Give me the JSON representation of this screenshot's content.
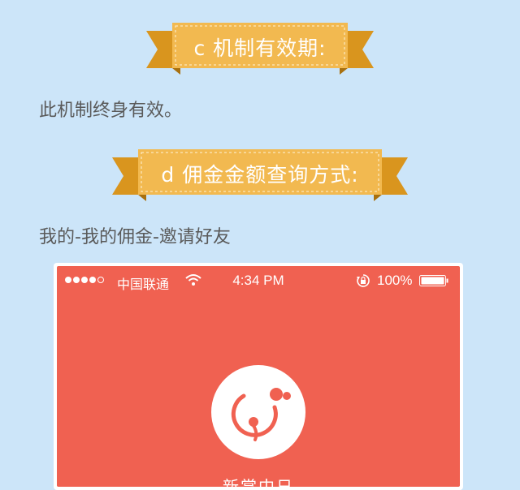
{
  "sections": [
    {
      "ribbon": "c 机制有效期:",
      "text": "此机制终身有效。"
    },
    {
      "ribbon": "d 佣金金额查询方式:",
      "text": "我的-我的佣金-邀请好友"
    }
  ],
  "phone": {
    "carrier": "中国联通",
    "time": "4:34 PM",
    "battery": "100%",
    "signal_bars_filled": 4,
    "signal_bars_total": 5,
    "app_name": "新掌中日"
  },
  "colors": {
    "background": "#cce5f9",
    "ribbon": "#f2b950",
    "ribbon_dark": "#d9951e",
    "screen": "#f06151",
    "text": "#5a5a5a"
  },
  "icons": [
    "wifi-icon",
    "rotation-lock-icon",
    "battery-icon",
    "app-logo-icon"
  ]
}
